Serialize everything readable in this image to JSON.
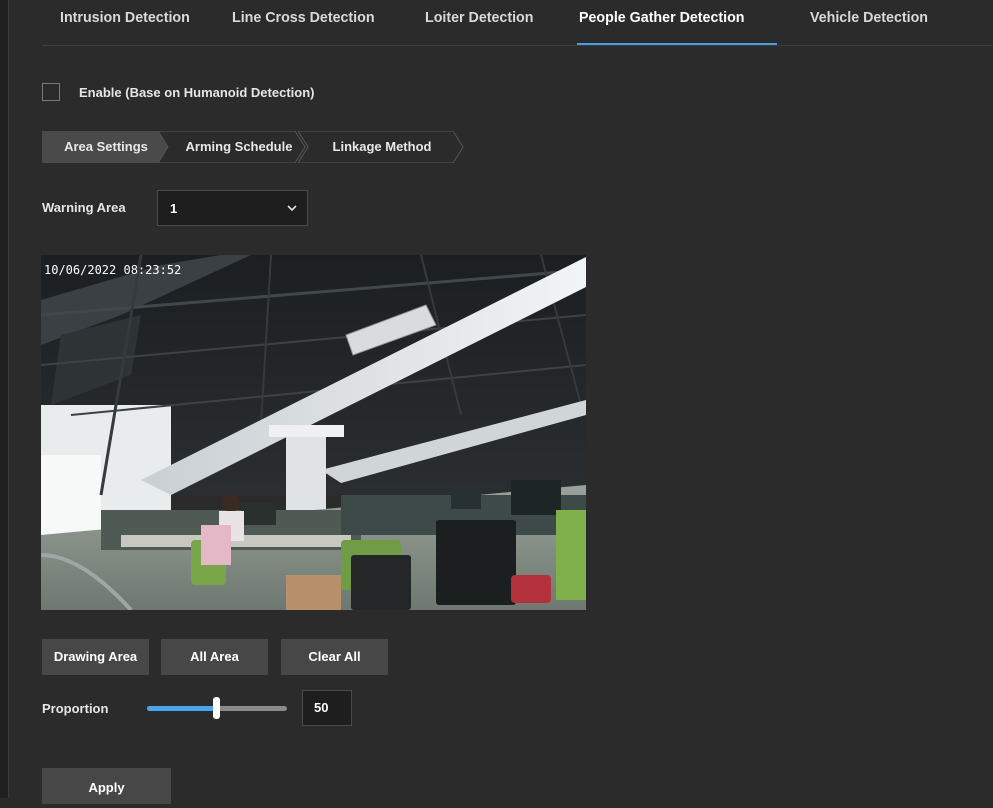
{
  "tabs": [
    {
      "label": "Intrusion Detection",
      "active": false
    },
    {
      "label": "Line Cross Detection",
      "active": false
    },
    {
      "label": "Loiter Detection",
      "active": false
    },
    {
      "label": "People Gather Detection",
      "active": true
    },
    {
      "label": "Vehicle Detection",
      "active": false
    }
  ],
  "enable": {
    "label": "Enable (Base on Humanoid Detection)",
    "checked": false
  },
  "steps": [
    {
      "label": "Area Settings",
      "active": true
    },
    {
      "label": "Arming Schedule",
      "active": false
    },
    {
      "label": "Linkage Method",
      "active": false
    }
  ],
  "warning_area": {
    "label": "Warning Area",
    "value": "1",
    "icon": "chevron-down-icon"
  },
  "video": {
    "timestamp": "10/06/2022 08:23:52"
  },
  "drawing": {
    "drawing_area": "Drawing Area",
    "all_area": "All Area",
    "clear_all": "Clear All"
  },
  "proportion": {
    "label": "Proportion",
    "value": "50",
    "fraction": 0.5
  },
  "apply_label": "Apply",
  "colors": {
    "background": "#2b2b2b",
    "accent": "#4a9ee8",
    "button": "#474747",
    "input_bg": "#1e1e1e"
  }
}
